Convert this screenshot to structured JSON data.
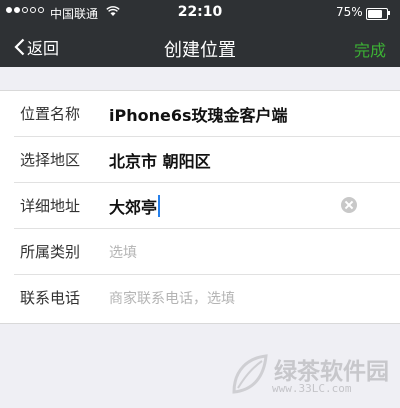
{
  "status_bar": {
    "carrier": "中国联通",
    "time": "22:10",
    "battery_pct": "75%",
    "battery_level": 0.75,
    "signal_bars": 2
  },
  "nav": {
    "back_label": "返回",
    "title": "创建位置",
    "done_label": "完成"
  },
  "form": {
    "name": {
      "label": "位置名称",
      "value": "iPhone6s玫瑰金客户端"
    },
    "region": {
      "label": "选择地区",
      "value": "北京市 朝阳区"
    },
    "address": {
      "label": "详细地址",
      "value": "大郊亭"
    },
    "category": {
      "label": "所属类别",
      "placeholder": "选填"
    },
    "phone": {
      "label": "联系电话",
      "placeholder": "商家联系电话，选填"
    }
  },
  "watermark": {
    "name": "绿茶软件园",
    "url": "www.33LC.com"
  },
  "colors": {
    "nav_bg": "#2e3134",
    "done": "#3cb034",
    "caret": "#2680eb",
    "page_bg": "#efeff4"
  }
}
